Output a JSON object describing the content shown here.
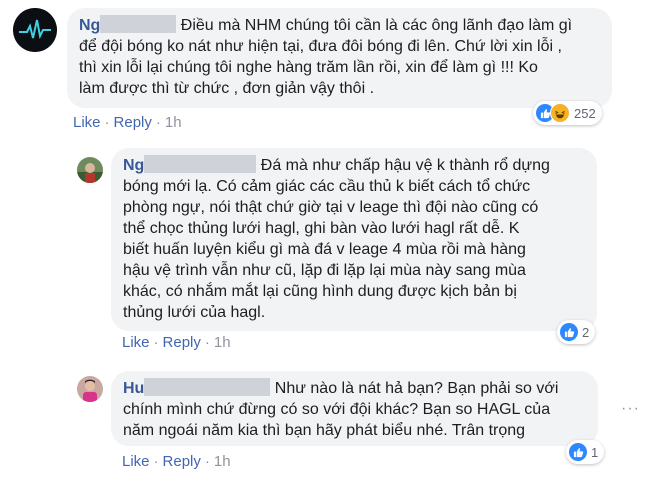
{
  "comments": [
    {
      "name_visible": "Ng",
      "lines": [
        "Điều mà NHM chúng tôi cần là các ông lãnh đạo làm gì",
        "để đội bóng ko nát như hiện tại, đưa đôi bóng đi lên. Chứ lời xin lỗi ,",
        "thì xin lỗi lại chúng tôi nghe hàng trăm lần rồi, xin để làm gì !!! Ko",
        "làm được thì từ chức , đơn giản vậy thôi ."
      ],
      "like_label": "Like",
      "reply_label": "Reply",
      "time": "1h",
      "reaction_icons": [
        "like-icon",
        "haha-icon"
      ],
      "reaction_count": "252"
    },
    {
      "name_visible": "Ng",
      "lines": [
        "Đá mà như chấp hậu vệ k thành rổ dựng",
        "bóng mới lạ. Có cảm giác các cầu thủ k biết cách tổ chức",
        "phòng ngự, nói thật chứ giờ tại v leage thì đội nào cũng có",
        "thể chọc thủng lưới hagl, ghi bàn vào lưới hagl rất dễ. K",
        "biết huấn luyện kiểu gì mà đá v leage 4 mùa rồi mà hàng",
        "hậu vệ trình vẫn như cũ, lặp đi lặp lại mùa này sang mùa",
        "khác, có nhắm mắt lại cũng hình dung được kịch bản bị",
        "thủng lưới của hagl."
      ],
      "like_label": "Like",
      "reply_label": "Reply",
      "time": "1h",
      "reaction_icons": [
        "like-icon"
      ],
      "reaction_count": "2"
    },
    {
      "name_visible": "Hu",
      "lines": [
        "Như nào là nát hả bạn? Bạn phải so với",
        "chính mình chứ đừng có so với đội khác? Bạn so HAGL của",
        "năm ngoái năm kia thì bạn hãy phát biểu nhé. Trân trọng"
      ],
      "like_label": "Like",
      "reply_label": "Reply",
      "time": "1h",
      "reaction_icons": [
        "like-icon"
      ],
      "reaction_count": "1"
    }
  ],
  "more_options_glyph": "···",
  "colors": {
    "link": "#4267b2",
    "name": "#385898",
    "bubble": "#f2f3f5",
    "meta": "#90949c",
    "like_blue": "#2d88ff",
    "haha_yellow": "#f7b125"
  }
}
